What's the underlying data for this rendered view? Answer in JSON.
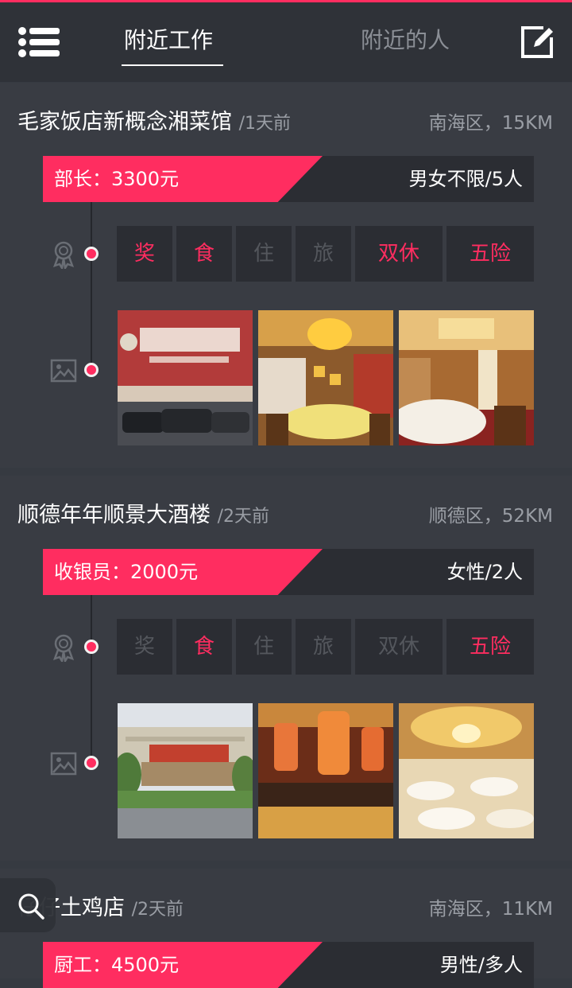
{
  "header": {
    "tab_jobs": "附近工作",
    "tab_people": "附近的人",
    "icons": {
      "menu": "menu-list-icon",
      "edit": "edit-icon"
    }
  },
  "colors": {
    "accent": "#ff2d60",
    "background": "#363a41",
    "card": "#393c43",
    "header": "#2f3238",
    "pill": "#2b2d33"
  },
  "jobs": [
    {
      "restaurant": "毛家饭店新概念湘菜馆",
      "time": "/1天前",
      "location": "南海区，15KM",
      "salary": "部长：3300元",
      "requirement": "男女不限/5人",
      "benefits": [
        {
          "label": "奖",
          "active": true
        },
        {
          "label": "食",
          "active": true
        },
        {
          "label": "住",
          "active": false
        },
        {
          "label": "旅",
          "active": false
        },
        {
          "label": "双休",
          "active": true
        },
        {
          "label": "五险",
          "active": true
        }
      ],
      "photos": [
        "storefront-photo",
        "dining-room-photo",
        "banquet-hall-photo"
      ]
    },
    {
      "restaurant": "顺德年年顺景大酒楼",
      "time": "/2天前",
      "location": "顺德区，52KM",
      "salary": "收银员：2000元",
      "requirement": "女性/2人",
      "benefits": [
        {
          "label": "奖",
          "active": false
        },
        {
          "label": "食",
          "active": true
        },
        {
          "label": "住",
          "active": false
        },
        {
          "label": "旅",
          "active": false
        },
        {
          "label": "双休",
          "active": false
        },
        {
          "label": "五险",
          "active": true
        }
      ],
      "photos": [
        "building-photo",
        "lantern-interior-photo",
        "banquet-hall-photo"
      ]
    },
    {
      "restaurant": "仔仔土鸡店",
      "time": "/2天前",
      "location": "南海区，11KM",
      "salary": "厨工：4500元",
      "requirement": "男性/多人",
      "benefits": [],
      "photos": []
    }
  ],
  "search_icon": "search-icon"
}
